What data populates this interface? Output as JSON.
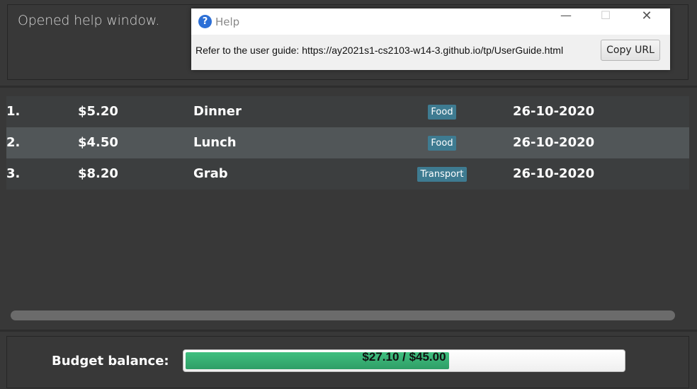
{
  "result": {
    "message": "Opened help window."
  },
  "help_window": {
    "title": "Help",
    "message": "Refer to the user guide: https://ay2021s1-cs2103-w14-3.github.io/tp/UserGuide.html",
    "copy_button": "Copy URL",
    "controls": {
      "minimize": "—",
      "maximize": "☐",
      "close": "✕"
    }
  },
  "expenses": [
    {
      "index": "1.",
      "amount": "$5.20",
      "description": "Dinner",
      "tag": "Food",
      "date": "26-10-2020"
    },
    {
      "index": "2.",
      "amount": "$4.50",
      "description": "Lunch",
      "tag": "Food",
      "date": "26-10-2020"
    },
    {
      "index": "3.",
      "amount": "$8.20",
      "description": "Grab",
      "tag": "Transport",
      "date": "26-10-2020"
    }
  ],
  "selected_row": 2,
  "budget": {
    "label": "Budget balance:",
    "balance_text": "$27.10 / $45.00",
    "balance": 27.1,
    "total": 45.0
  },
  "colors": {
    "background": "#383838",
    "tag": "#3e7b91",
    "progress": "#3fbf80",
    "selected_row": "#515658"
  },
  "icons": {
    "help": "question-circle-icon"
  }
}
